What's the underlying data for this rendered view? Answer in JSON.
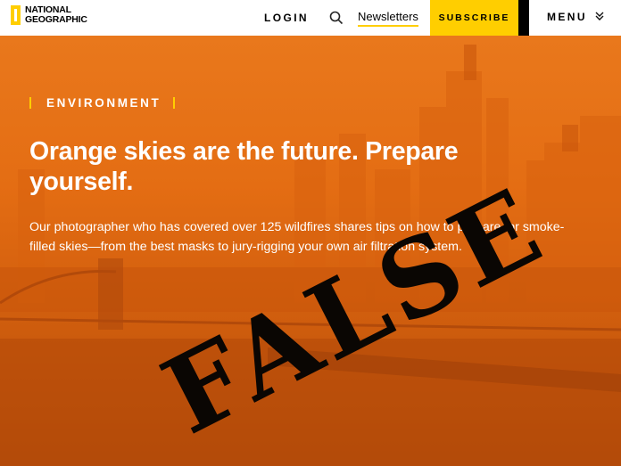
{
  "header": {
    "logo_line1": "NATIONAL",
    "logo_line2": "GEOGRAPHIC",
    "login": "LOGIN",
    "newsletters": "Newsletters",
    "subscribe": "SUBSCRIBE",
    "menu": "MENU"
  },
  "article": {
    "category": "ENVIRONMENT",
    "headline": "Orange skies are the future. Prepare yourself.",
    "dek": "Our photographer who has covered over 125 wildfires shares tips on how to prepare for smoke-filled skies—from the best masks to jury-rigging your own air filtration system."
  },
  "overlay": {
    "stamp": "FALSE"
  },
  "colors": {
    "accent_yellow": "#ffce00",
    "hero_orange": "#e46d13",
    "stamp": "#0a0603"
  }
}
